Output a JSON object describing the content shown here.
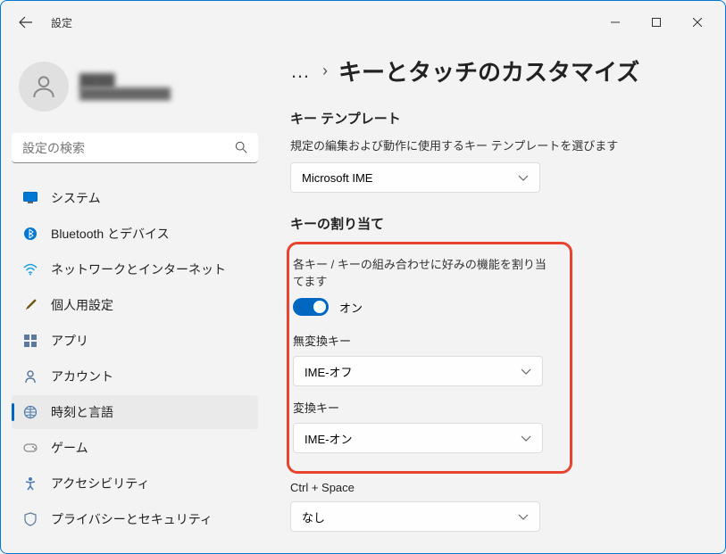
{
  "window": {
    "title": "設定"
  },
  "user": {
    "name": "████",
    "email": "████████████"
  },
  "search": {
    "placeholder": "設定の検索"
  },
  "sidebar": {
    "items": [
      {
        "label": "システム"
      },
      {
        "label": "Bluetooth とデバイス"
      },
      {
        "label": "ネットワークとインターネット"
      },
      {
        "label": "個人用設定"
      },
      {
        "label": "アプリ"
      },
      {
        "label": "アカウント"
      },
      {
        "label": "時刻と言語"
      },
      {
        "label": "ゲーム"
      },
      {
        "label": "アクセシビリティ"
      },
      {
        "label": "プライバシーとセキュリティ"
      }
    ]
  },
  "breadcrumb": {
    "more": "…",
    "title": "キーとタッチのカスタマイズ"
  },
  "section1": {
    "title": "キー テンプレート",
    "desc": "規定の編集および動作に使用するキー テンプレートを選びます",
    "dropdown": "Microsoft IME"
  },
  "section2": {
    "title": "キーの割り当て",
    "desc": "各キー / キーの組み合わせに好みの機能を割り当てます",
    "toggle_label": "オン",
    "field1_label": "無変換キー",
    "field1_value": "IME-オフ",
    "field2_label": "変換キー",
    "field2_value": "IME-オン",
    "field3_label": "Ctrl + Space",
    "field3_value": "なし"
  }
}
